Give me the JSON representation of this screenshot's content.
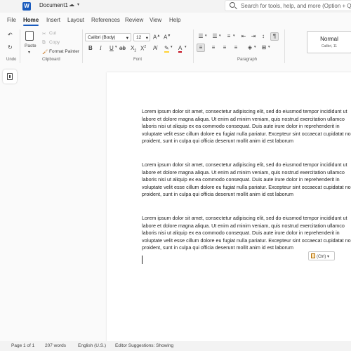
{
  "titlebar": {
    "app_icon": "word-icon",
    "doc_title": "Document1",
    "search_placeholder": "Search for tools, help, and more (Option + Q)"
  },
  "tabs": [
    "File",
    "Home",
    "Insert",
    "Layout",
    "References",
    "Review",
    "View",
    "Help"
  ],
  "active_tab": "Home",
  "ribbon": {
    "undo_label": "Undo",
    "paste_label": "Paste",
    "cut_label": "Cut",
    "copy_label": "Copy",
    "format_painter_label": "Format Painter",
    "clipboard_group": "Clipboard",
    "font_name": "Calibri (Body)",
    "font_size": "12",
    "font_group": "Font",
    "paragraph_group": "Paragraph",
    "style_name": "Normal",
    "style_sub": "Calibri, 11"
  },
  "document": {
    "paragraphs": [
      [
        "Lorem ipsum dolor sit amet, consectetur adipiscing elit, sed do eiusmod tempor incididunt ut",
        "labore et dolore magna aliqua. Ut enim ad minim veniam, quis nostrud exercitation ullamco",
        "laboris nisi ut aliquip ex ea commodo consequat. Duis aute irure dolor in reprehenderit in",
        "voluptate velit esse cillum dolore eu fugiat nulla pariatur. Excepteur sint occaecat cupidatat non",
        "proident, sunt in culpa qui officia deserunt mollit anim id est laborum"
      ],
      [
        "Lorem ipsum dolor sit amet, consectetur adipiscing elit, sed do eiusmod tempor incididunt ut",
        "labore et dolore magna aliqua. Ut enim ad minim veniam, quis nostrud exercitation ullamco",
        "laboris nisi ut aliquip ex ea commodo consequat. Duis aute irure dolor in reprehenderit in",
        "voluptate velit esse cillum dolore eu fugiat nulla pariatur. Excepteur sint occaecat cupidatat non",
        "proident, sunt in culpa qui officia deserunt mollit anim id est laborum"
      ],
      [
        "Lorem ipsum dolor sit amet, consectetur adipiscing elit, sed do eiusmod tempor incididunt ut",
        "labore et dolore magna aliqua. Ut enim ad minim veniam, quis nostrud exercitation ullamco",
        "laboris nisi ut aliquip ex ea commodo consequat. Duis aute irure dolor in reprehenderit in",
        "voluptate velit esse cillum dolore eu fugiat nulla pariatur. Excepteur sint occaecat cupidatat non",
        "proident, sunt in culpa qui officia deserunt mollit anim id est laborum"
      ]
    ],
    "paste_options_label": "(Ctrl)"
  },
  "status": {
    "page": "Page 1 of 1",
    "words": "207 words",
    "language": "English (U.S.)",
    "editor": "Editor Suggestions: Showing"
  },
  "colors": {
    "accent": "#185abd",
    "font_color": "#c50f1f",
    "highlight": "#ffd335"
  }
}
